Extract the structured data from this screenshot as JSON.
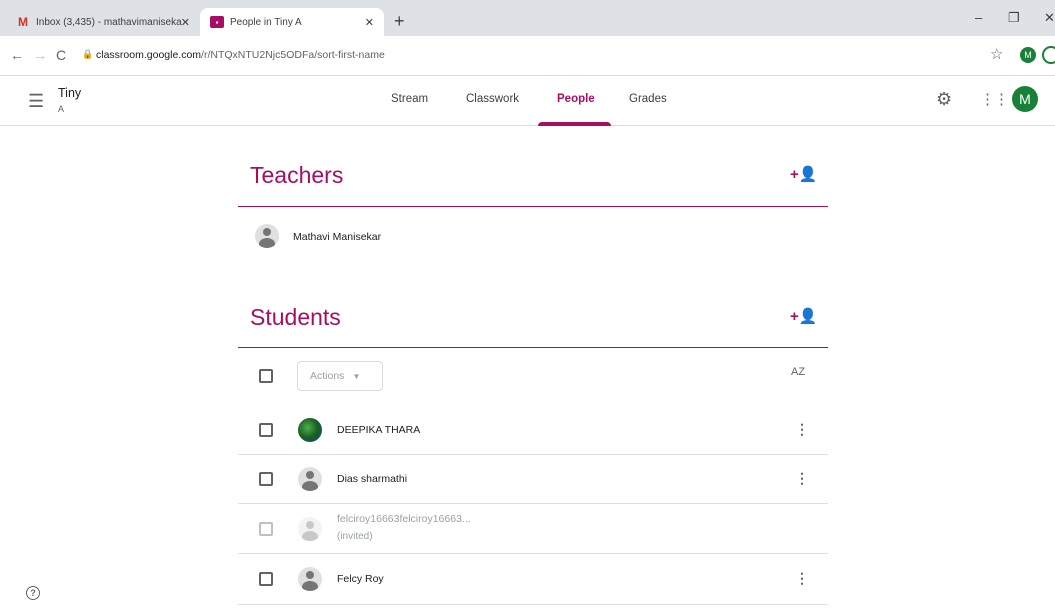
{
  "browser": {
    "tabs": [
      {
        "title": "Inbox (3,435) - mathavimaniseka"
      },
      {
        "title": "People in Tiny A"
      }
    ],
    "new_tab": "+",
    "url_host": "classroom.google.com",
    "url_path": "/r/NTQxNTU2Njc5ODFa/sort-first-name",
    "profile_initial": "M"
  },
  "header": {
    "class_name": "Tiny",
    "section": "A",
    "nav": [
      {
        "label": "Stream"
      },
      {
        "label": "Classwork"
      },
      {
        "label": "People"
      },
      {
        "label": "Grades"
      }
    ],
    "active_nav": "People",
    "avatar_initial": "M"
  },
  "teachers": {
    "title": "Teachers",
    "list": [
      {
        "name": "Mathavi Manisekar"
      }
    ]
  },
  "students": {
    "title": "Students",
    "actions_label": "Actions",
    "sort_label": "AZ",
    "list": [
      {
        "name": "DEEPIKA THARA",
        "status": ""
      },
      {
        "name": "Dias sharmathi",
        "status": ""
      },
      {
        "name": "felciroy16663felciroy16663...",
        "status": "(invited)"
      },
      {
        "name": "Felcy Roy",
        "status": ""
      }
    ]
  },
  "colors": {
    "accent": "#a50e62",
    "avatar_green": "#188038"
  }
}
